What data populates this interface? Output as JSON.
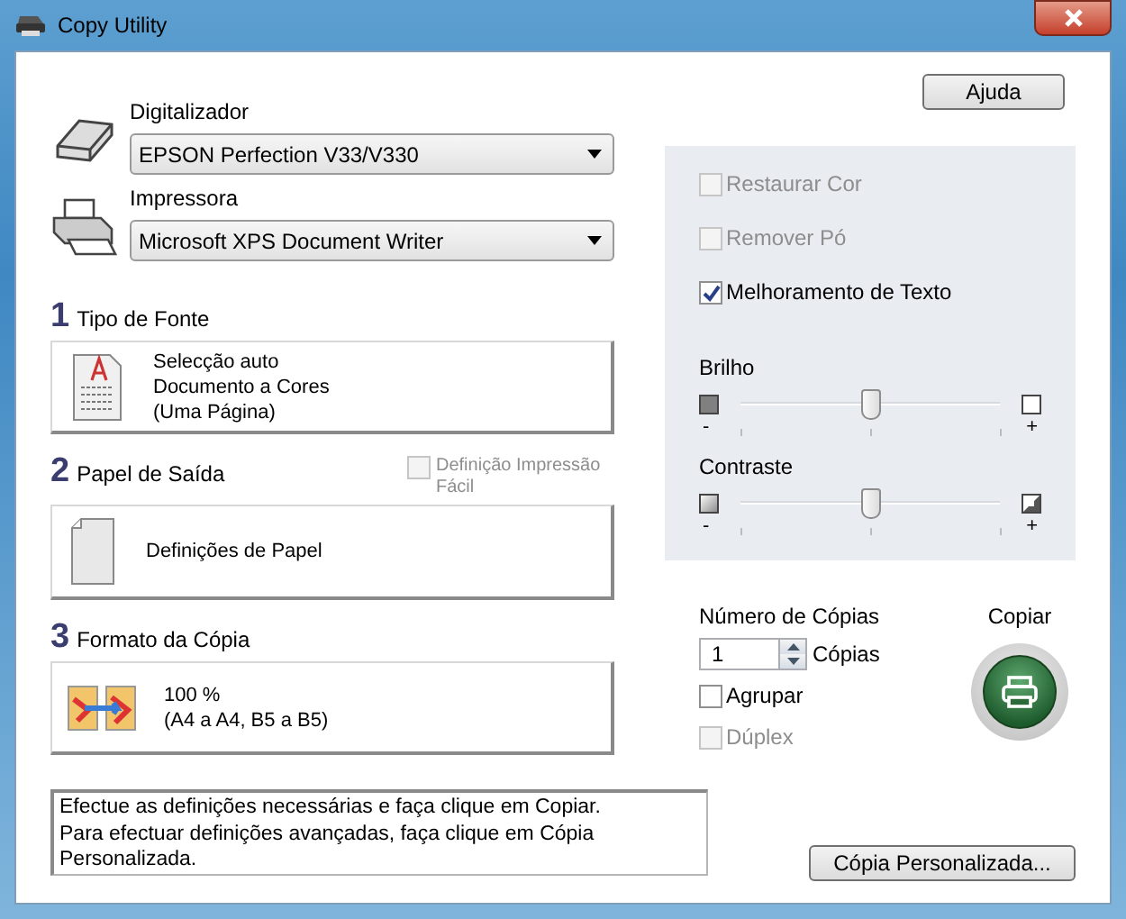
{
  "window": {
    "title": "Copy Utility"
  },
  "help_button": {
    "label": "Ajuda"
  },
  "devices": [
    {
      "kind": "scanner",
      "label": "Digitalizador",
      "value": "EPSON Perfection V33/V330"
    },
    {
      "kind": "printer",
      "label": "Impressora",
      "value": "Microsoft XPS Document Writer"
    }
  ],
  "sections": [
    {
      "kind": "document",
      "number": "1",
      "title": "Tipo de Fonte",
      "lines": [
        "Selecção auto",
        "Documento a Cores",
        "(Uma Página)"
      ]
    },
    {
      "kind": "paper",
      "number": "2",
      "title": "Papel de Saída",
      "lines": [
        "Definições de Papel"
      ],
      "option": {
        "label": "Definição Impressão Fácil",
        "checked": false,
        "disabled": true
      }
    },
    {
      "kind": "format",
      "number": "3",
      "title": "Formato da Cópia",
      "lines": [
        "100 %",
        "(A4 a A4, B5 a B5)"
      ]
    }
  ],
  "options": [
    {
      "label": "Restaurar Cor",
      "checked": false,
      "disabled": true
    },
    {
      "label": "Remover Pó",
      "checked": false,
      "disabled": true
    },
    {
      "label": "Melhoramento de Texto",
      "checked": true,
      "disabled": false
    }
  ],
  "sliders": [
    {
      "kind": "brightness",
      "label": "Brilho",
      "level": 0.5,
      "min_label": "-",
      "max_label": "+"
    },
    {
      "kind": "contrast",
      "label": "Contraste",
      "level": 0.5,
      "min_label": "-",
      "max_label": "+"
    }
  ],
  "copies": {
    "label": "Número de Cópias",
    "value": "1",
    "unit": "Cópias"
  },
  "copy_options": [
    {
      "label": "Agrupar",
      "checked": false,
      "disabled": false
    },
    {
      "label": "Dúplex",
      "checked": false,
      "disabled": true
    }
  ],
  "copy_button": {
    "label": "Copiar"
  },
  "message": [
    "Efectue as definições necessárias e faça clique em Copiar.",
    "Para efectuar definições avançadas, faça clique em Cópia Personalizada."
  ],
  "custom_button": {
    "label": "Cópia Personalizada..."
  }
}
